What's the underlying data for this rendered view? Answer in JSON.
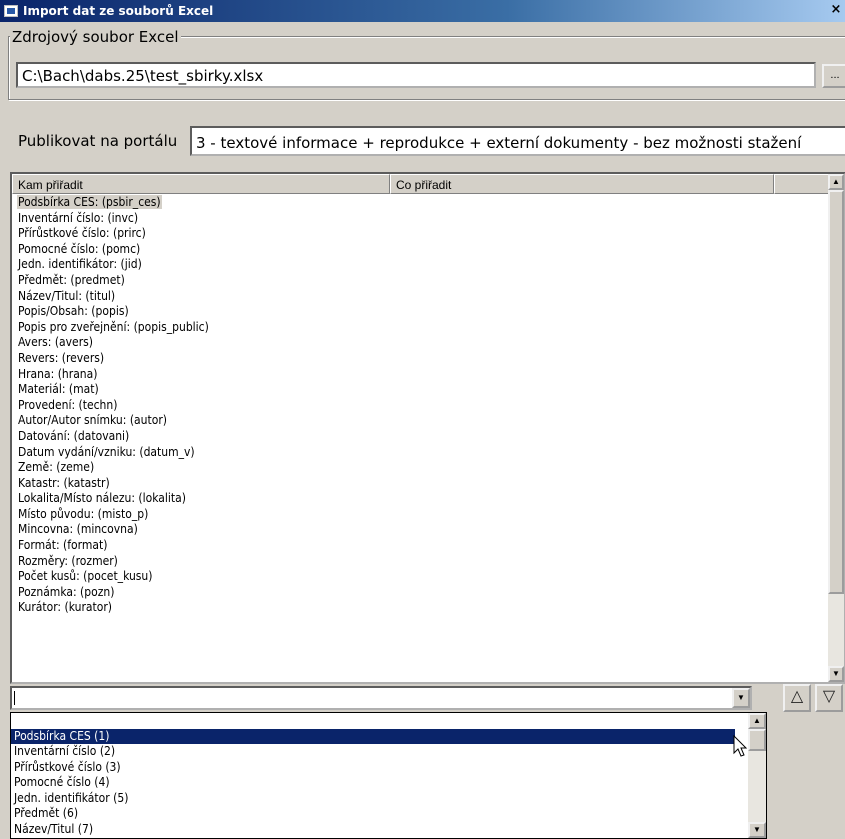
{
  "window": {
    "title": "Import dat ze souborů Excel",
    "close_label": "×"
  },
  "source": {
    "legend": "Zdrojový soubor Excel",
    "path": "C:\\Bach\\dabs.25\\test_sbirky.xlsx",
    "browse_label": "..."
  },
  "publish": {
    "label": "Publikovat na portálu",
    "value": "3 - textové informace + reprodukce + externí dokumenty - bez možnosti stažení"
  },
  "mapping": {
    "columns": [
      "Kam přiřadit",
      "Co přiřadit",
      ""
    ],
    "rows": [
      "Podsbírka CES: (psbir_ces)",
      "Inventární číslo: (invc)",
      "Přírůstkové číslo: (prirc)",
      "Pomocné číslo: (pomc)",
      "Jedn. identifikátor: (jid)",
      "Předmět: (predmet)",
      "Název/Titul: (titul)",
      "Popis/Obsah: (popis)",
      "Popis pro zveřejnění: (popis_public)",
      "Avers: (avers)",
      "Revers: (revers)",
      "Hrana: (hrana)",
      "Materiál: (mat)",
      "Provedení: (techn)",
      "Autor/Autor snímku: (autor)",
      "Datování: (datovani)",
      "Datum vydání/vzniku: (datum_v)",
      "Země: (zeme)",
      "Katastr: (katastr)",
      "Lokalita/Místo nálezu: (lokalita)",
      "Místo původu: (misto_p)",
      "Mincovna: (mincovna)",
      "Formát: (format)",
      "Rozměry: (rozmer)",
      "Počet kusů: (pocet_kusu)",
      "Poznámka: (pozn)",
      "Kurátor: (kurator)"
    ],
    "selected_index": 0
  },
  "combo": {
    "value": ""
  },
  "move_up_icon": "up-triangle",
  "move_down_icon": "down-triangle",
  "dropdown": {
    "items": [
      "",
      "Podsbírka CES (1)",
      "Inventární číslo (2)",
      "Přírůstkové číslo (3)",
      "Pomocné číslo (4)",
      "Jedn. identifikátor (5)",
      "Předmět (6)",
      "Název/Titul (7)"
    ],
    "selected_index": 1
  },
  "colors": {
    "selection": "#0a246a",
    "face": "#d4d0c8"
  }
}
